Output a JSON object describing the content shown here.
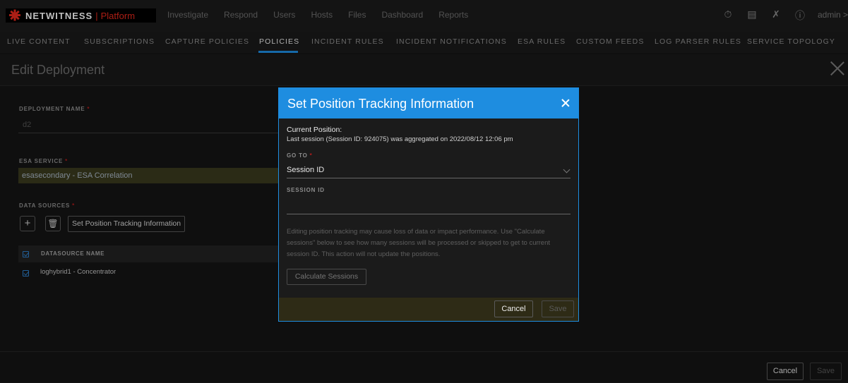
{
  "app": {
    "brand": "NETWITNESS",
    "separator": "|",
    "product": "Platform",
    "top_nav": [
      "Investigate",
      "Respond",
      "Users",
      "Hosts",
      "Files",
      "Dashboard",
      "Reports"
    ],
    "user": "admin >",
    "icons": [
      "timer-icon",
      "list-icon",
      "tools-icon",
      "help-icon"
    ]
  },
  "subnav": {
    "items": [
      "LIVE CONTENT",
      "SUBSCRIPTIONS",
      "CAPTURE POLICIES",
      "POLICIES",
      "INCIDENT RULES",
      "INCIDENT NOTIFICATIONS",
      "ESA RULES",
      "CUSTOM FEEDS",
      "LOG PARSER RULES",
      "SERVICE TOPOLOGY"
    ],
    "active": "POLICIES"
  },
  "page": {
    "title": "Edit Deployment",
    "deployment_name_label": "DEPLOYMENT NAME",
    "deployment_name_value": "d2",
    "esa_service_label": "ESA SERVICE",
    "esa_service_value": "esasecondary - ESA Correlation",
    "data_sources_label": "DATA SOURCES",
    "set_position_button": "Set Position Tracking Information",
    "table_header": "DATASOURCE NAME",
    "rows": [
      "loghybrid1 - Concentrator"
    ],
    "required_mark": "*",
    "cancel": "Cancel",
    "save": "Save"
  },
  "modal": {
    "title": "Set Position Tracking Information",
    "current_position_label": "Current Position:",
    "current_position_text": "Last session (Session ID: 924075) was aggregated on 2022/08/12 12:06 pm",
    "goto_label": "GO TO",
    "goto_value": "Session ID",
    "session_id_label": "SESSION ID",
    "session_id_value": "",
    "warning": "Editing position tracking may cause loss of data or impact performance. Use \"Calculate sessions\" below to see how many sessions will be processed or skipped to get to current session ID. This action will not update the positions.",
    "calculate_button": "Calculate Sessions",
    "cancel": "Cancel",
    "save": "Save",
    "required_mark": "*"
  },
  "colors": {
    "accent": "#1e8de0",
    "brand_red": "#e5281c",
    "required": "#b21d1d"
  }
}
